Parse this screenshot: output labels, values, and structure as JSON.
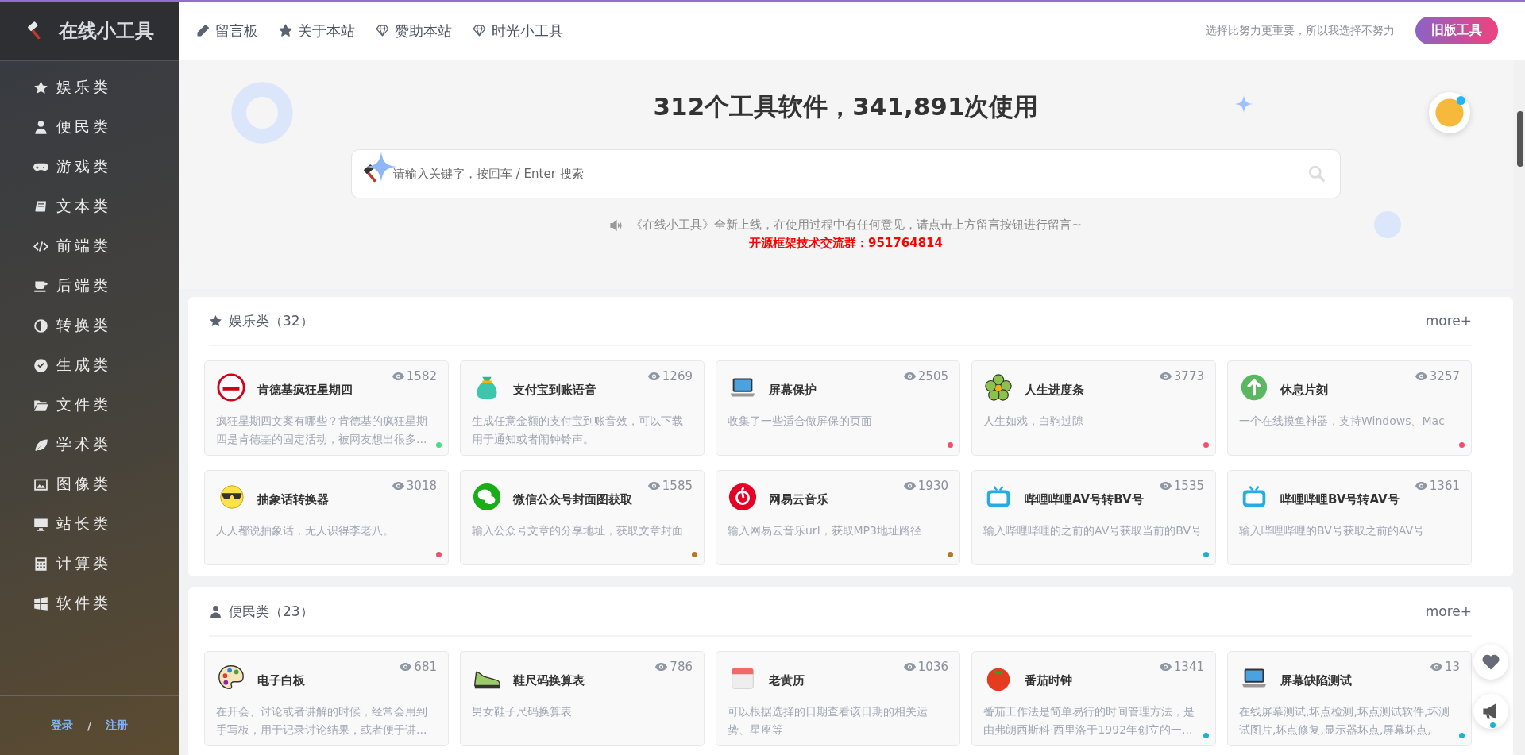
{
  "sidebar": {
    "logo": "在线小工具",
    "items": [
      {
        "label": "娱乐类"
      },
      {
        "label": "便民类"
      },
      {
        "label": "游戏类"
      },
      {
        "label": "文本类"
      },
      {
        "label": "前端类"
      },
      {
        "label": "后端类"
      },
      {
        "label": "转换类"
      },
      {
        "label": "生成类"
      },
      {
        "label": "文件类"
      },
      {
        "label": "学术类"
      },
      {
        "label": "图像类"
      },
      {
        "label": "站长类"
      },
      {
        "label": "计算类"
      },
      {
        "label": "软件类"
      }
    ],
    "login": "登录",
    "separator": "/",
    "register": "注册"
  },
  "topbar": {
    "links": [
      {
        "label": "留言板"
      },
      {
        "label": "关于本站"
      },
      {
        "label": "赞助本站"
      },
      {
        "label": "时光小工具"
      }
    ],
    "slogan": "选择比努力更重要，所以我选择不努力",
    "old_button": "旧版工具"
  },
  "hero": {
    "title": "312个工具软件，341,891次使用",
    "search_placeholder": "请输入关键字，按回车 / Enter 搜索",
    "notice": "《在线小工具》全新上线，在使用过程中有任何意见，请点击上方留言按钮进行留言~",
    "group": "开源框架技术交流群：951764814"
  },
  "sections": [
    {
      "title": "娱乐类（32）",
      "more": "more+",
      "tools": [
        {
          "name": "肯德基疯狂星期四",
          "views": "1582",
          "desc": "疯狂星期四文案有哪些？肯德基的疯狂星期四是肯德基的固定活动，被网友想出很多...",
          "color": "#4ade80"
        },
        {
          "name": "支付宝到账语音",
          "views": "1269",
          "desc": "生成任意金额的支付宝到账音效，可以下载用于通知或者闹钟铃声。"
        },
        {
          "name": "屏幕保护",
          "views": "2505",
          "desc": "收集了一些适合做屏保的页面",
          "color": "#f0506e"
        },
        {
          "name": "人生进度条",
          "views": "3773",
          "desc": "人生如戏，白驹过隙",
          "color": "#f0506e"
        },
        {
          "name": "休息片刻",
          "views": "3257",
          "desc": "一个在线摸鱼神器，支持Windows、Mac",
          "color": "#f0506e"
        },
        {
          "name": "抽象话转换器",
          "views": "3018",
          "desc": "人人都说抽象话，无人识得李老八。",
          "color": "#f0506e"
        },
        {
          "name": "微信公众号封面图获取",
          "views": "1585",
          "desc": "输入公众号文章的分享地址，获取文章封面",
          "color": "#b7791f"
        },
        {
          "name": "网易云音乐",
          "views": "1930",
          "desc": "输入网易云音乐url，获取MP3地址路径",
          "color": "#b7791f"
        },
        {
          "name": "哔哩哔哩AV号转BV号",
          "views": "1535",
          "desc": "输入哔哩哔哩的之前的AV号获取当前的BV号",
          "color": "#17b3d1"
        },
        {
          "name": "哔哩哔哩BV号转AV号",
          "views": "1361",
          "desc": "输入哔哩哔哩的BV号获取之前的AV号"
        }
      ]
    },
    {
      "title": "便民类（23）",
      "more": "more+",
      "tools": [
        {
          "name": "电子白板",
          "views": "681",
          "desc": "在开会、讨论或者讲解的时候，经常会用到手写板，用于记录讨论结果，或者便于讲..."
        },
        {
          "name": "鞋尺码换算表",
          "views": "786",
          "desc": "男女鞋子尺码换算表"
        },
        {
          "name": "老黄历",
          "views": "1036",
          "desc": "可以根据选择的日期查看该日期的相关运势、星座等"
        },
        {
          "name": "番茄时钟",
          "views": "1341",
          "desc": "番茄工作法是简单易行的时间管理方法，是由弗朗西斯科·西里洛于1992年创立的一...",
          "color": "#17b3d1"
        },
        {
          "name": "屏幕缺陷测试",
          "views": "13",
          "desc": "在线屏幕测试,坏点检测,坏点测试软件,坏测试图片,坏点修复,显示器坏点,屏幕坏点,",
          "color": "#17b3d1"
        }
      ]
    }
  ]
}
